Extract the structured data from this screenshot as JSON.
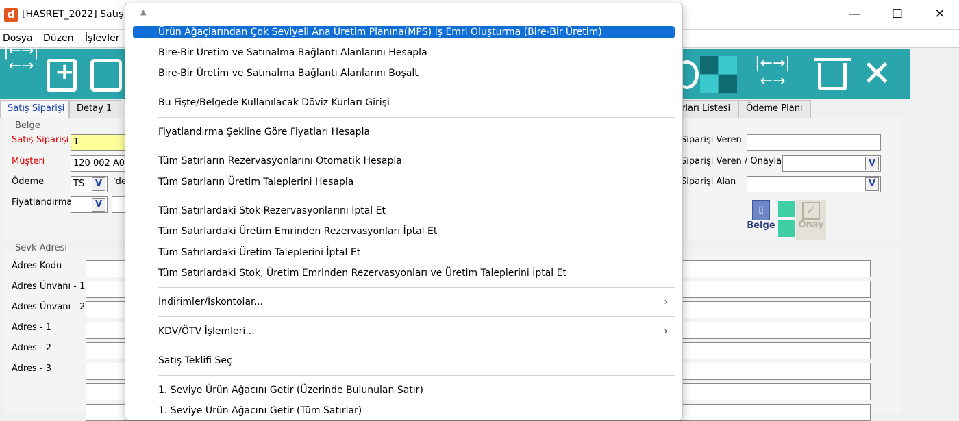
{
  "window": {
    "title": "[HASRET_2022] Satış S",
    "icon_letter": "d"
  },
  "menubar": [
    "Dosya",
    "Düzen",
    "İşlevler"
  ],
  "tabs": {
    "left": [
      "Satış Siparişi",
      "Detay 1"
    ],
    "right": [
      "rları Listesi",
      "Ödeme Planı"
    ]
  },
  "form": {
    "belge_group": "Belge",
    "satis_siparisi_label": "Satış Siparişi",
    "satis_siparisi_value": "1",
    "musteri_label": "Müşteri",
    "musteri_value": "120 002 A0",
    "odeme_label": "Ödeme",
    "odeme_value": "TS",
    "odeme_extra": "'de",
    "fiyatlandirma_label": "Fiyatlandırma",
    "right_labels": [
      "Siparişi Veren",
      "Siparişi Veren / Onaylay",
      "Siparişi Alan"
    ],
    "belge_button": "Belge",
    "onay_button": "Onay",
    "sevk_group": "Sevk Adresi",
    "sevk_labels": [
      "Adres Kodu",
      "Adres Ünvanı - 1",
      "Adres Ünvanı - 2",
      "Adres - 1",
      "Adres - 2",
      "Adres - 3"
    ],
    "dropdown_glyph": "V"
  },
  "context_menu": {
    "items": [
      {
        "label": "Ürün Ağaçlarından Çok Seviyeli Ana Üretim Planına(MPS) İş Emri Oluşturma (Bire-Bir Üretim)",
        "highlighted": true
      },
      {
        "label": "Bire-Bir Üretim ve Satınalma Bağlantı Alanlarını Hesapla"
      },
      {
        "label": "Bire-Bir Üretim ve Satınalma Bağlantı Alanlarını Boşalt"
      },
      {
        "label": "Bu Fişte/Belgede Kullanılacak Döviz Kurları Girişi"
      },
      {
        "label": "Fiyatlandırma Şekline Göre Fiyatları Hesapla"
      },
      {
        "label": "Tüm Satırların Rezervasyonlarını Otomatik Hesapla"
      },
      {
        "label": "Tüm Satırların Üretim Taleplerini Hesapla"
      },
      {
        "label": "Tüm Satırlardaki Stok Rezervasyonlarını İptal Et"
      },
      {
        "label": "Tüm Satırlardaki Üretim Emrinden Rezervasyonları İptal Et"
      },
      {
        "label": "Tüm Satırlardaki Üretim Taleplerini İptal Et"
      },
      {
        "label": "Tüm Satırlardaki Stok, Üretim Emrinden Rezervasyonları ve Üretim Taleplerini İptal Et"
      },
      {
        "label": "İndirimler/İskontolar...",
        "submenu": true
      },
      {
        "label": "KDV/ÖTV İşlemleri...",
        "submenu": true
      },
      {
        "label": "Satış Teklifi Seç"
      },
      {
        "label": "1. Seviye Ürün Ağacını Getir (Üzerinde Bulunulan Satır)"
      },
      {
        "label": "1. Seviye Ürün Ağacını Getir (Tüm Satırlar)"
      }
    ]
  },
  "colors": {
    "toolbar": "#2aa5ac",
    "highlight": "#0f6fd6",
    "required_label": "#e00000",
    "edit_yellow": "#ffff99"
  }
}
